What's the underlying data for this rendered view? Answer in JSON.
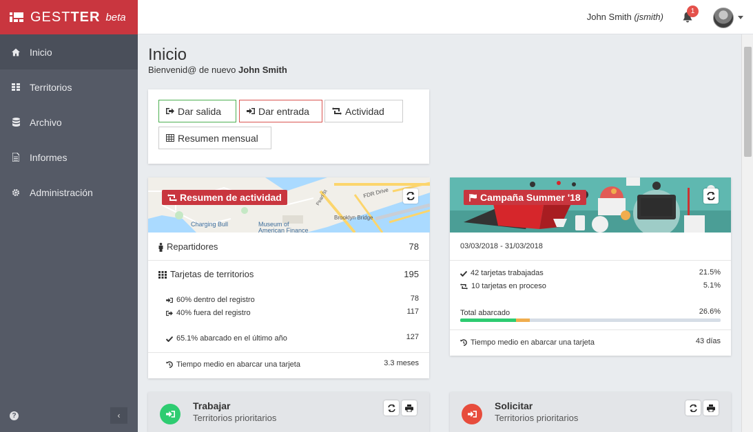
{
  "app": {
    "name_light": "GEST",
    "name_bold": "TER",
    "beta": "beta"
  },
  "sidebar": {
    "items": [
      {
        "label": "Inicio",
        "icon": "home-icon"
      },
      {
        "label": "Territorios",
        "icon": "grid-icon"
      },
      {
        "label": "Archivo",
        "icon": "database-icon"
      },
      {
        "label": "Informes",
        "icon": "file-icon"
      },
      {
        "label": "Administración",
        "icon": "gear-icon"
      }
    ],
    "help": "?",
    "collapse": "‹"
  },
  "topbar": {
    "user_name": "John Smith",
    "user_handle": "(jsmith)",
    "notifications": "1"
  },
  "page": {
    "title": "Inicio",
    "welcome": "Bienvenid@ de nuevo",
    "welcome_name": "John Smith"
  },
  "actions": {
    "out": "Dar salida",
    "in": "Dar entrada",
    "activity": "Actividad",
    "monthly": "Resumen mensual"
  },
  "activity_card": {
    "title": "Resumen de actividad",
    "map_labels": [
      "Charging Bull",
      "Museum of",
      "American Finance",
      "Brooklyn Bridge",
      "FDR Drive",
      "Pearl St"
    ],
    "repartidores_label": "Repartidores",
    "repartidores_value": "78",
    "tarjetas_label": "Tarjetas de territorios",
    "tarjetas_value": "195",
    "dentro_label": "60% dentro del registro",
    "dentro_value": "78",
    "fuera_label": "40% fuera del registro",
    "fuera_value": "117",
    "abarcado_label": "65.1% abarcado en el último año",
    "abarcado_value": "127",
    "tiempo_label": "Tiempo medio en abarcar una tarjeta",
    "tiempo_value": "3.3 meses"
  },
  "campaign_card": {
    "title": "Campaña Summer '18",
    "dates": "03/03/2018 - 31/03/2018",
    "trabajadas_label": "42 tarjetas trabajadas",
    "trabajadas_value": "21.5%",
    "proceso_label": "10 tarjetas en proceso",
    "proceso_value": "5.1%",
    "total_label": "Total abarcado",
    "total_value": "26.6%",
    "progress_done": 0.215,
    "progress_in_process": 0.051,
    "tiempo_label": "Tiempo medio en abarcar una tarjeta",
    "tiempo_value": "43 días"
  },
  "bottom_cards": {
    "work": {
      "title": "Trabajar",
      "subtitle": "Territorios prioritarios"
    },
    "request": {
      "title": "Solicitar",
      "subtitle": "Territorios prioritarios"
    }
  },
  "colors": {
    "brand": "#c9363f",
    "sidebar": "#555a66",
    "green": "#2ecc71",
    "red": "#e74c3c",
    "orange": "#f0ad4e"
  }
}
